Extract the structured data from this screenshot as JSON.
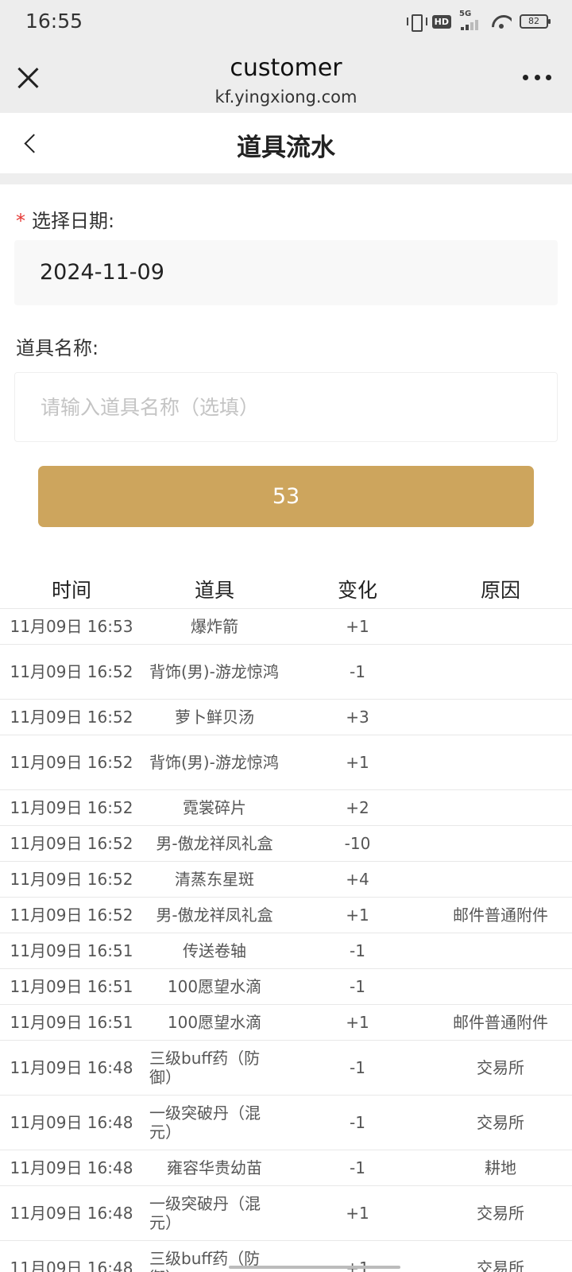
{
  "status_bar": {
    "time": "16:55",
    "hd_label": "HD",
    "network_label": "5G",
    "battery": "82",
    "icons": [
      "vibrate-icon",
      "hd-icon",
      "5g-signal-icon",
      "wifi-icon",
      "battery-icon"
    ]
  },
  "browser": {
    "title": "customer",
    "url": "kf.yingxiong.com",
    "icons": [
      "close-icon",
      "more-icon"
    ]
  },
  "page": {
    "title": "道具流水",
    "back_icon": "chevron-left-icon"
  },
  "form": {
    "date_required_mark": "*",
    "date_label": "选择日期:",
    "date_value": "2024-11-09",
    "item_label": "道具名称:",
    "item_placeholder": "请输入道具名称（选填）",
    "item_value": "",
    "query_button_label": "53"
  },
  "table": {
    "headers": [
      "时间",
      "道具",
      "变化",
      "原因"
    ],
    "rows": [
      {
        "time": "11月09日 16:53",
        "item": "爆炸箭",
        "delta": "+1",
        "reason": ""
      },
      {
        "time": "11月09日 16:52",
        "item": "背饰(男)-游龙惊鸿",
        "delta": "-1",
        "reason": ""
      },
      {
        "time": "11月09日 16:52",
        "item": "萝卜鲜贝汤",
        "delta": "+3",
        "reason": ""
      },
      {
        "time": "11月09日 16:52",
        "item": "背饰(男)-游龙惊鸿",
        "delta": "+1",
        "reason": ""
      },
      {
        "time": "11月09日 16:52",
        "item": "霓裳碎片",
        "delta": "+2",
        "reason": ""
      },
      {
        "time": "11月09日 16:52",
        "item": "男-傲龙祥凤礼盒",
        "delta": "-10",
        "reason": ""
      },
      {
        "time": "11月09日 16:52",
        "item": "清蒸东星斑",
        "delta": "+4",
        "reason": ""
      },
      {
        "time": "11月09日 16:52",
        "item": "男-傲龙祥凤礼盒",
        "delta": "+1",
        "reason": "邮件普通附件"
      },
      {
        "time": "11月09日 16:51",
        "item": "传送卷轴",
        "delta": "-1",
        "reason": ""
      },
      {
        "time": "11月09日 16:51",
        "item": "100愿望水滴",
        "delta": "-1",
        "reason": ""
      },
      {
        "time": "11月09日 16:51",
        "item": "100愿望水滴",
        "delta": "+1",
        "reason": "邮件普通附件"
      },
      {
        "time": "11月09日 16:48",
        "item": "三级buff药（防御）",
        "delta": "-1",
        "reason": "交易所"
      },
      {
        "time": "11月09日 16:48",
        "item": "一级突破丹（混元）",
        "delta": "-1",
        "reason": "交易所"
      },
      {
        "time": "11月09日 16:48",
        "item": "雍容华贵幼苗",
        "delta": "-1",
        "reason": "耕地"
      },
      {
        "time": "11月09日 16:48",
        "item": "一级突破丹（混元）",
        "delta": "+1",
        "reason": "交易所"
      },
      {
        "time": "11月09日 16:48",
        "item": "三级buff药（防御）",
        "delta": "+1",
        "reason": "交易所"
      }
    ]
  }
}
